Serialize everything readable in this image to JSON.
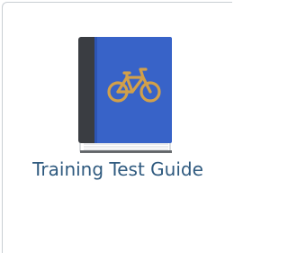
{
  "tile": {
    "label": "Training Test Guide",
    "icon": "bicycle-book-icon",
    "colors": {
      "book_cover": "#3863c8",
      "book_spine": "#3a3d42",
      "bicycle": "#d2a04a",
      "label": "#2f5a7f",
      "border": "#c9ced3"
    }
  }
}
